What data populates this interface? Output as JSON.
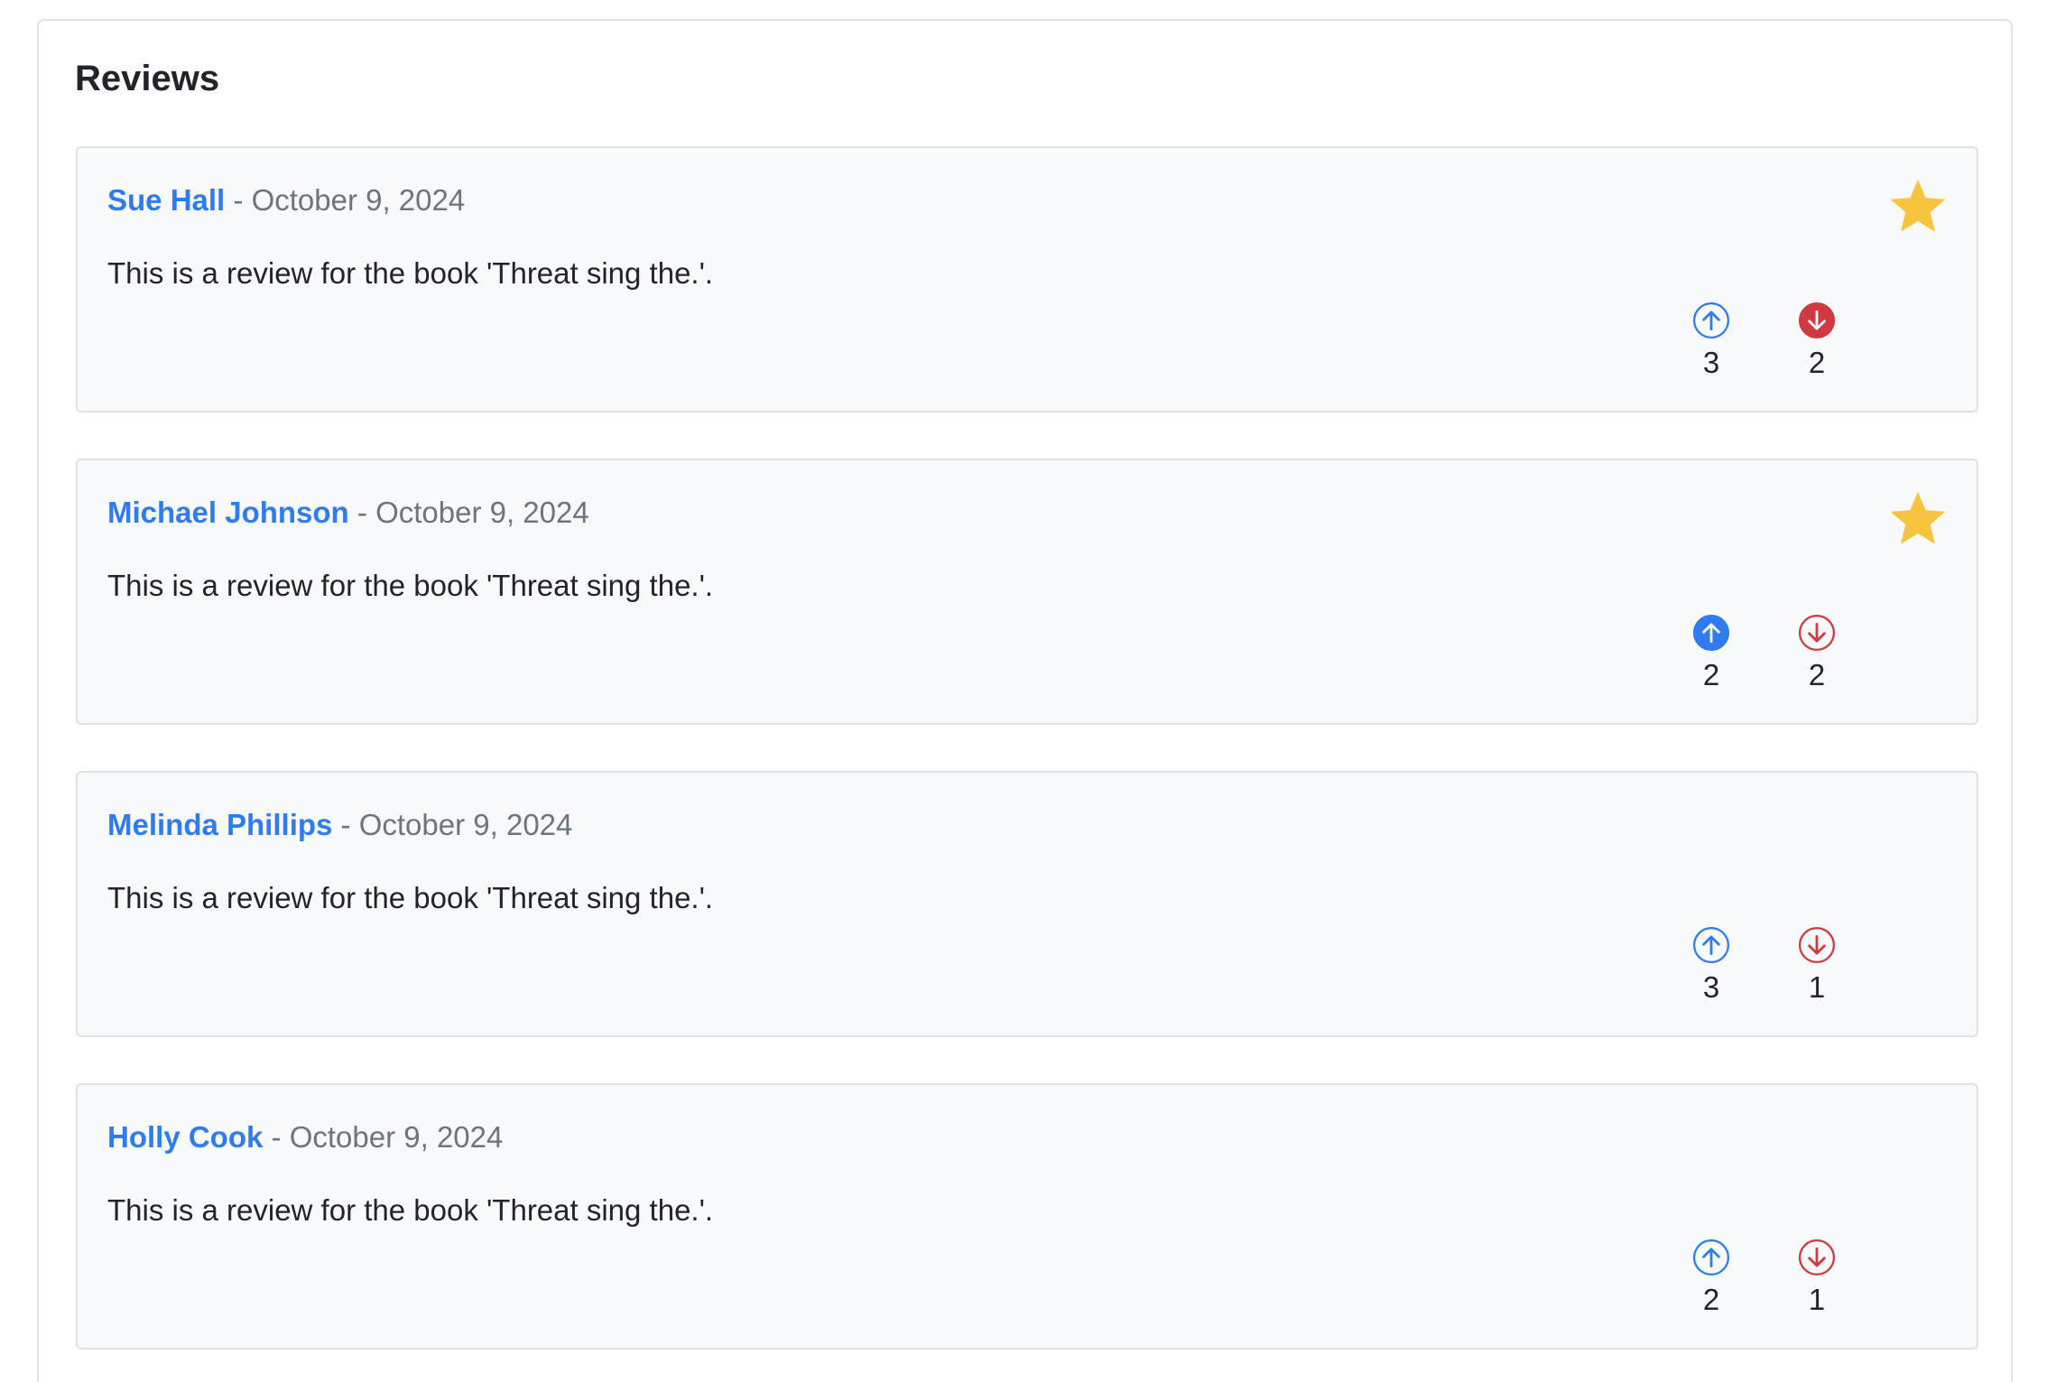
{
  "panel": {
    "title": "Reviews"
  },
  "colors": {
    "link": "#2f7bf1",
    "upvote": "#2f7bf1",
    "downvote": "#d0393f",
    "star": "#f7c43e"
  },
  "reviews": [
    {
      "author": "Sue Hall",
      "separator": "-",
      "date": "October 9, 2024",
      "text": "This is a review for the book 'Threat sing the.'.",
      "starred": true,
      "upvotes": "3",
      "downvotes": "2",
      "upvote_active": false,
      "downvote_active": true
    },
    {
      "author": "Michael Johnson",
      "separator": "-",
      "date": "October 9, 2024",
      "text": "This is a review for the book 'Threat sing the.'.",
      "starred": true,
      "upvotes": "2",
      "downvotes": "2",
      "upvote_active": true,
      "downvote_active": false
    },
    {
      "author": "Melinda Phillips",
      "separator": "-",
      "date": "October 9, 2024",
      "text": "This is a review for the book 'Threat sing the.'.",
      "starred": false,
      "upvotes": "3",
      "downvotes": "1",
      "upvote_active": false,
      "downvote_active": false
    },
    {
      "author": "Holly Cook",
      "separator": "-",
      "date": "October 9, 2024",
      "text": "This is a review for the book 'Threat sing the.'.",
      "starred": false,
      "upvotes": "2",
      "downvotes": "1",
      "upvote_active": false,
      "downvote_active": false
    }
  ]
}
